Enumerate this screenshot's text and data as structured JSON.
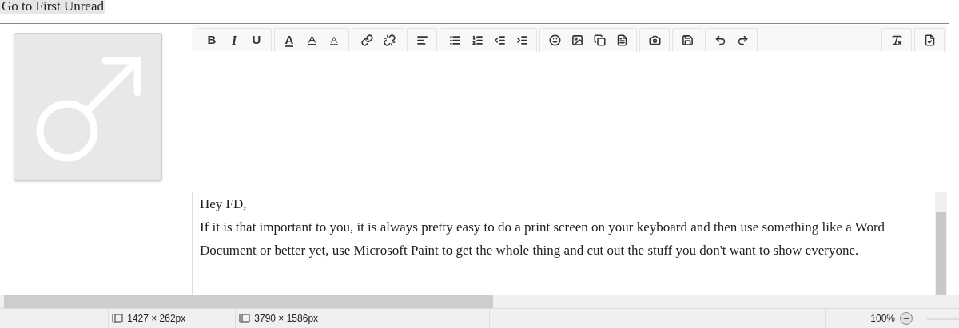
{
  "top_button": "Go to First Unread",
  "toolbar": {
    "bold": "B",
    "italic": "I",
    "underline": "U",
    "font_color": "A"
  },
  "message": {
    "greeting": "Hey FD,",
    "body": "If it is that important to you, it is always pretty easy to do a print screen on your keyboard and then use something like a Word Document or better yet, use Microsoft Paint to get the whole thing and cut out the stuff you don't want to show everyone."
  },
  "status_bar": {
    "selection_size": "1427 × 262px",
    "image_size": "3790 × 1586px",
    "zoom": "100%"
  }
}
